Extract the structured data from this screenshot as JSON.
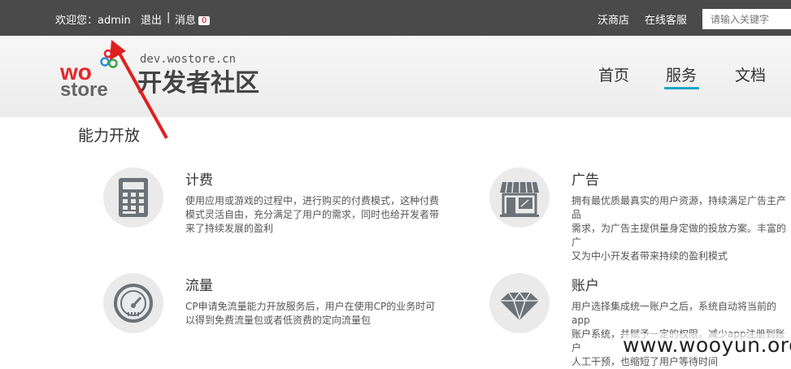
{
  "topbar": {
    "welcome": "欢迎您：admin",
    "logout": "退出",
    "separator": "|",
    "messages_label": "消息",
    "messages_count": "0",
    "store": "沃商店",
    "support": "在线客服",
    "search_placeholder": "请输入关键字"
  },
  "header": {
    "logo_word_wo": "wo",
    "logo_word_store": "store",
    "domain": "dev.wostore.cn",
    "site_name": "开发者社区",
    "nav": [
      {
        "label": "首页"
      },
      {
        "label": "服务",
        "active": true
      },
      {
        "label": "文档"
      }
    ]
  },
  "main": {
    "section_title": "能力开放",
    "features": [
      {
        "title": "计费",
        "icon": "calculator-icon",
        "desc": "使用应用或游戏的过程中，进行购买的付费模式，这种付费\n模式灵活自由，充分满足了用户的需求，同时也给开发者带\n来了持续发展的盈利"
      },
      {
        "title": "广告",
        "icon": "storefront-icon",
        "desc": "拥有最优质最真实的用户资源，持续满足广告主产品\n需求，为广告主提供量身定做的投放方案。丰富的广\n又为中小开发者带来持续的盈利模式"
      },
      {
        "title": "流量",
        "icon": "gauge-icon",
        "desc": "CP申请免流量能力开放服务后，用户在使用CP的业务时可\n以得到免费流量包或者低资费的定向流量包"
      },
      {
        "title": "账户",
        "icon": "diamond-icon",
        "desc": "用户选择集成统一账户之后，系统自动将当前的app\n账户系统，并赋予一定的权限。减少app注册到账户\n人工干预，也缩短了用户等待时间"
      }
    ]
  },
  "watermark": "www.wooyun.org",
  "colors": {
    "topbar": "#4a4a4a",
    "accent": "#1ea7c4",
    "arrow": "#e02020"
  }
}
